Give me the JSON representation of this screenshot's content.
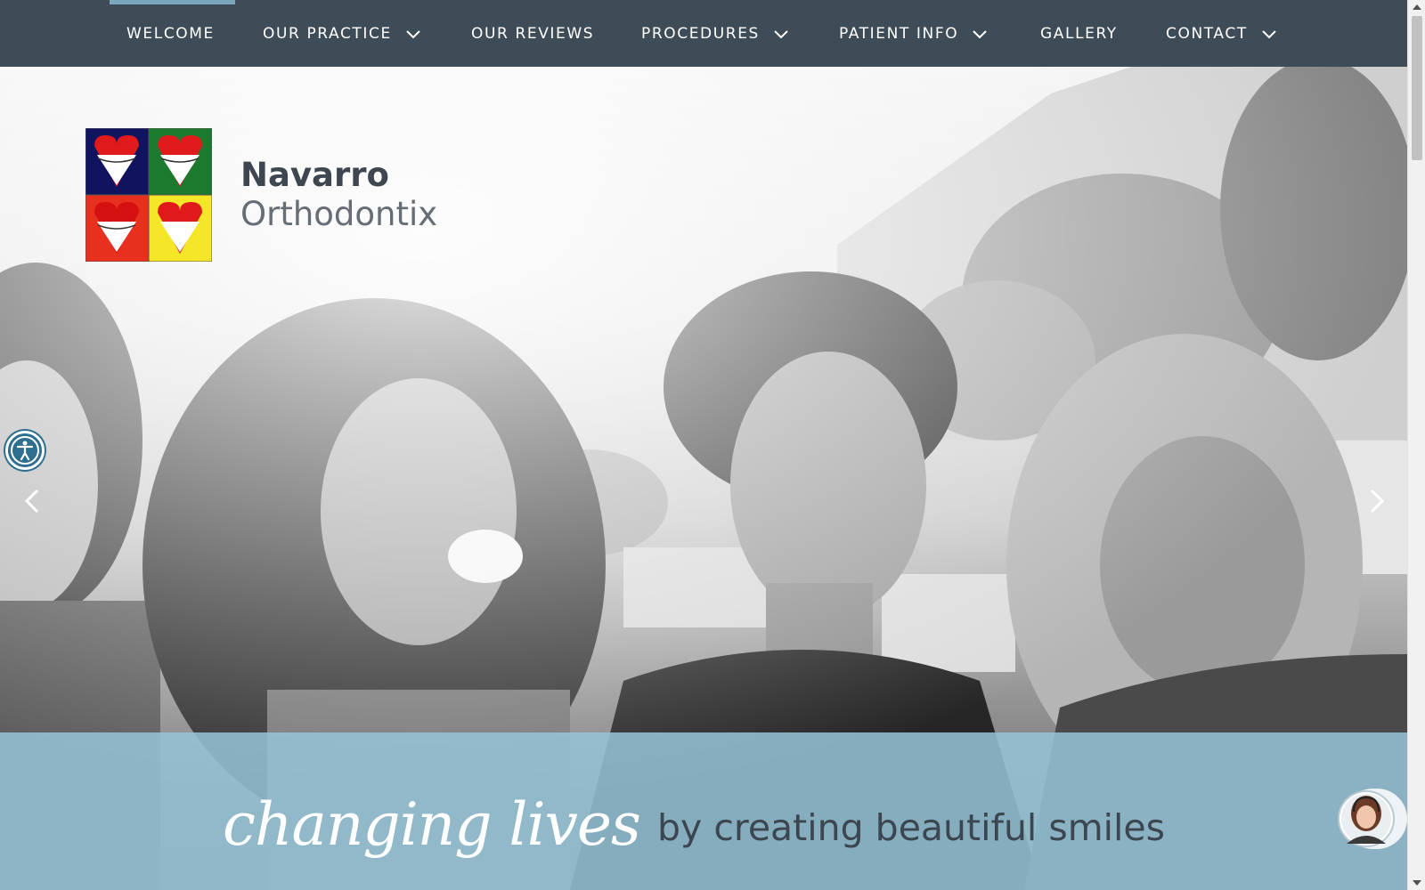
{
  "nav": {
    "items": [
      {
        "label": "WELCOME",
        "active": true,
        "has_dropdown": false
      },
      {
        "label": "OUR PRACTICE",
        "active": false,
        "has_dropdown": true
      },
      {
        "label": "OUR REVIEWS",
        "active": false,
        "has_dropdown": false
      },
      {
        "label": "PROCEDURES",
        "active": false,
        "has_dropdown": true
      },
      {
        "label": "PATIENT INFO",
        "active": false,
        "has_dropdown": true
      },
      {
        "label": "GALLERY",
        "active": false,
        "has_dropdown": false
      },
      {
        "label": "CONTACT",
        "active": false,
        "has_dropdown": true
      }
    ]
  },
  "brand": {
    "name_line1": "Navarro",
    "name_line2": "Orthodontix"
  },
  "tagline": {
    "script": "changing lives",
    "rest": "by creating beautiful smiles"
  },
  "colors": {
    "nav_bg": "#3e4c57",
    "nav_active": "#7aa7be",
    "band": "#96c4d6",
    "logo_navy": "#10145e",
    "logo_green": "#1b7a2e",
    "logo_red": "#e8301e",
    "logo_yellow": "#f5e628",
    "heart_red": "#e01a1a"
  },
  "icons": {
    "accessibility": "accessibility-icon",
    "prev": "chevron-left-icon",
    "next": "chevron-right-icon",
    "dropdown": "chevron-down-icon",
    "chat": "chat-agent-avatar-icon"
  }
}
